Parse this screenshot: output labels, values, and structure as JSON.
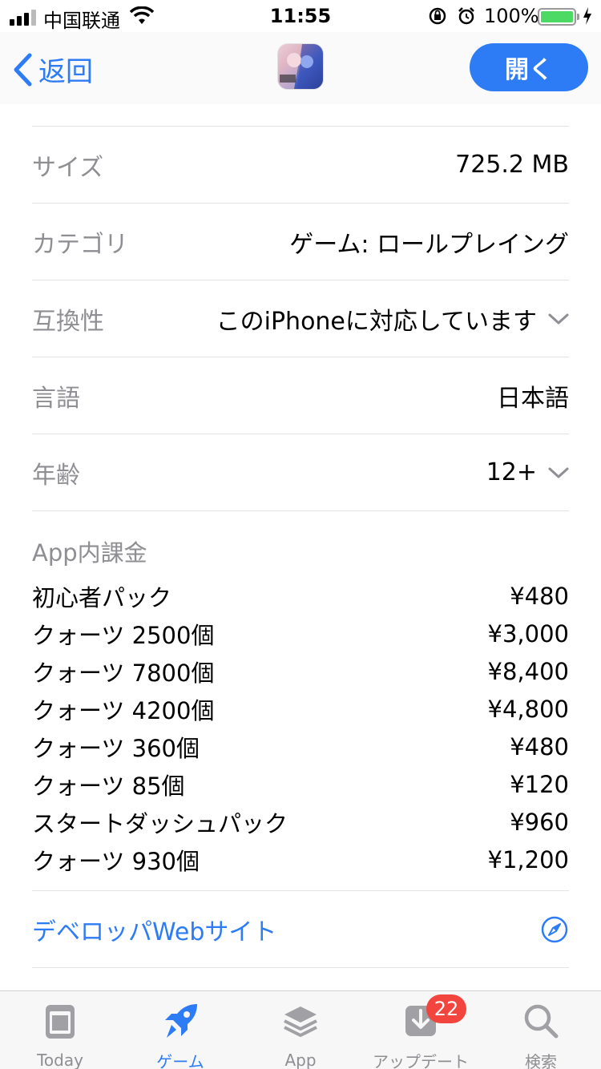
{
  "status_bar": {
    "carrier": "中国联通",
    "time": "11:55",
    "battery": "100%"
  },
  "nav": {
    "back_label": "返回",
    "open_label": "開く"
  },
  "info_rows": [
    {
      "label": "サイズ",
      "value": "725.2 MB",
      "expandable": false
    },
    {
      "label": "カテゴリ",
      "value": "ゲーム: ロールプレイング",
      "expandable": false
    },
    {
      "label": "互換性",
      "value": "このiPhoneに対応しています",
      "expandable": true
    },
    {
      "label": "言語",
      "value": "日本語",
      "expandable": false
    },
    {
      "label": "年齢",
      "value": "12+",
      "expandable": true
    }
  ],
  "iap": {
    "title": "App内課金",
    "items": [
      {
        "name": "初心者パック",
        "price": "¥480"
      },
      {
        "name": "クォーツ 2500個",
        "price": "¥3,000"
      },
      {
        "name": "クォーツ 7800個",
        "price": "¥8,400"
      },
      {
        "name": "クォーツ 4200個",
        "price": "¥4,800"
      },
      {
        "name": "クォーツ 360個",
        "price": "¥480"
      },
      {
        "name": "クォーツ 85個",
        "price": "¥120"
      },
      {
        "name": "スタートダッシュパック",
        "price": "¥960"
      },
      {
        "name": "クォーツ 930個",
        "price": "¥1,200"
      }
    ]
  },
  "developer_link": {
    "label": "デベロッパWebサイト",
    "icon": "compass-icon"
  },
  "tabs": [
    {
      "label": "Today",
      "icon": "today-icon",
      "active": false
    },
    {
      "label": "ゲーム",
      "icon": "rocket-icon",
      "active": true
    },
    {
      "label": "App",
      "icon": "layers-icon",
      "active": false
    },
    {
      "label": "アップデート",
      "icon": "download-icon",
      "active": false,
      "badge": "22"
    },
    {
      "label": "検索",
      "icon": "search-icon",
      "active": false
    }
  ],
  "colors": {
    "accent": "#2d7cf6",
    "secondary_text": "#8e8e93",
    "badge": "#f2453d",
    "battery": "#4cd964"
  }
}
